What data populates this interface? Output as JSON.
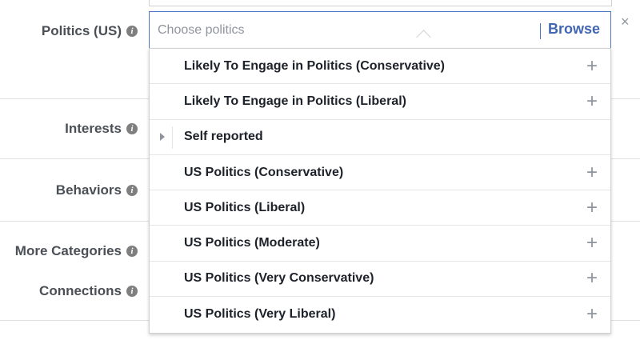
{
  "form": {
    "labels": {
      "politics": "Politics (US)",
      "interests": "Interests",
      "behaviors": "Behaviors",
      "more_categories": "More Categories",
      "connections": "Connections"
    },
    "info_icon_glyph": "i"
  },
  "search": {
    "value": "",
    "placeholder": "Choose politics",
    "browse_label": "Browse",
    "close_glyph": "×"
  },
  "dropdown": {
    "plus_glyph": "+",
    "items": [
      {
        "label": "Likely To Engage in Politics (Conservative)",
        "type": "option"
      },
      {
        "label": "Likely To Engage in Politics (Liberal)",
        "type": "option"
      },
      {
        "label": "Self reported",
        "type": "category"
      },
      {
        "label": "US Politics (Conservative)",
        "type": "option"
      },
      {
        "label": "US Politics (Liberal)",
        "type": "option"
      },
      {
        "label": "US Politics (Moderate)",
        "type": "option"
      },
      {
        "label": "US Politics (Very Conservative)",
        "type": "option"
      },
      {
        "label": "US Politics (Very Liberal)",
        "type": "option"
      }
    ]
  },
  "colors": {
    "accent": "#4267b2",
    "input_border_focus": "#4b78c5",
    "label": "#4b4f56",
    "divider": "#dddfe2"
  }
}
